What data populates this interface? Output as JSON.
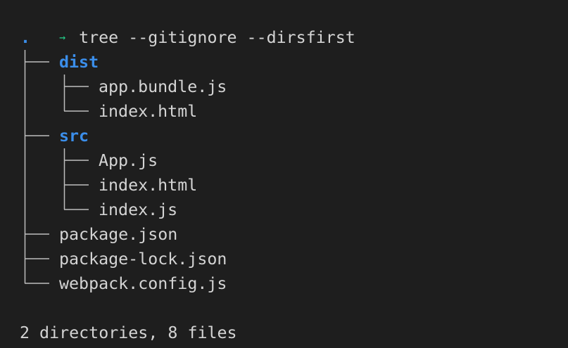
{
  "terminal": {
    "prompt_symbol": "→",
    "command": "tree --gitignore --dirsfirst",
    "root": ".",
    "entries": [
      {
        "name": "dist",
        "type": "dir"
      },
      {
        "name": "app.bundle.js",
        "type": "file"
      },
      {
        "name": "index.html",
        "type": "file"
      },
      {
        "name": "src",
        "type": "dir"
      },
      {
        "name": "App.js",
        "type": "file"
      },
      {
        "name": "index.html",
        "type": "file"
      },
      {
        "name": "index.js",
        "type": "file"
      },
      {
        "name": "package.json",
        "type": "file"
      },
      {
        "name": "package-lock.json",
        "type": "file"
      },
      {
        "name": "webpack.config.js",
        "type": "file"
      }
    ],
    "summary": "2 directories, 8 files"
  },
  "colors": {
    "background": "#1e1e1e",
    "text": "#d4d4d4",
    "directory": "#3b8eea",
    "prompt": "#23d18b"
  }
}
